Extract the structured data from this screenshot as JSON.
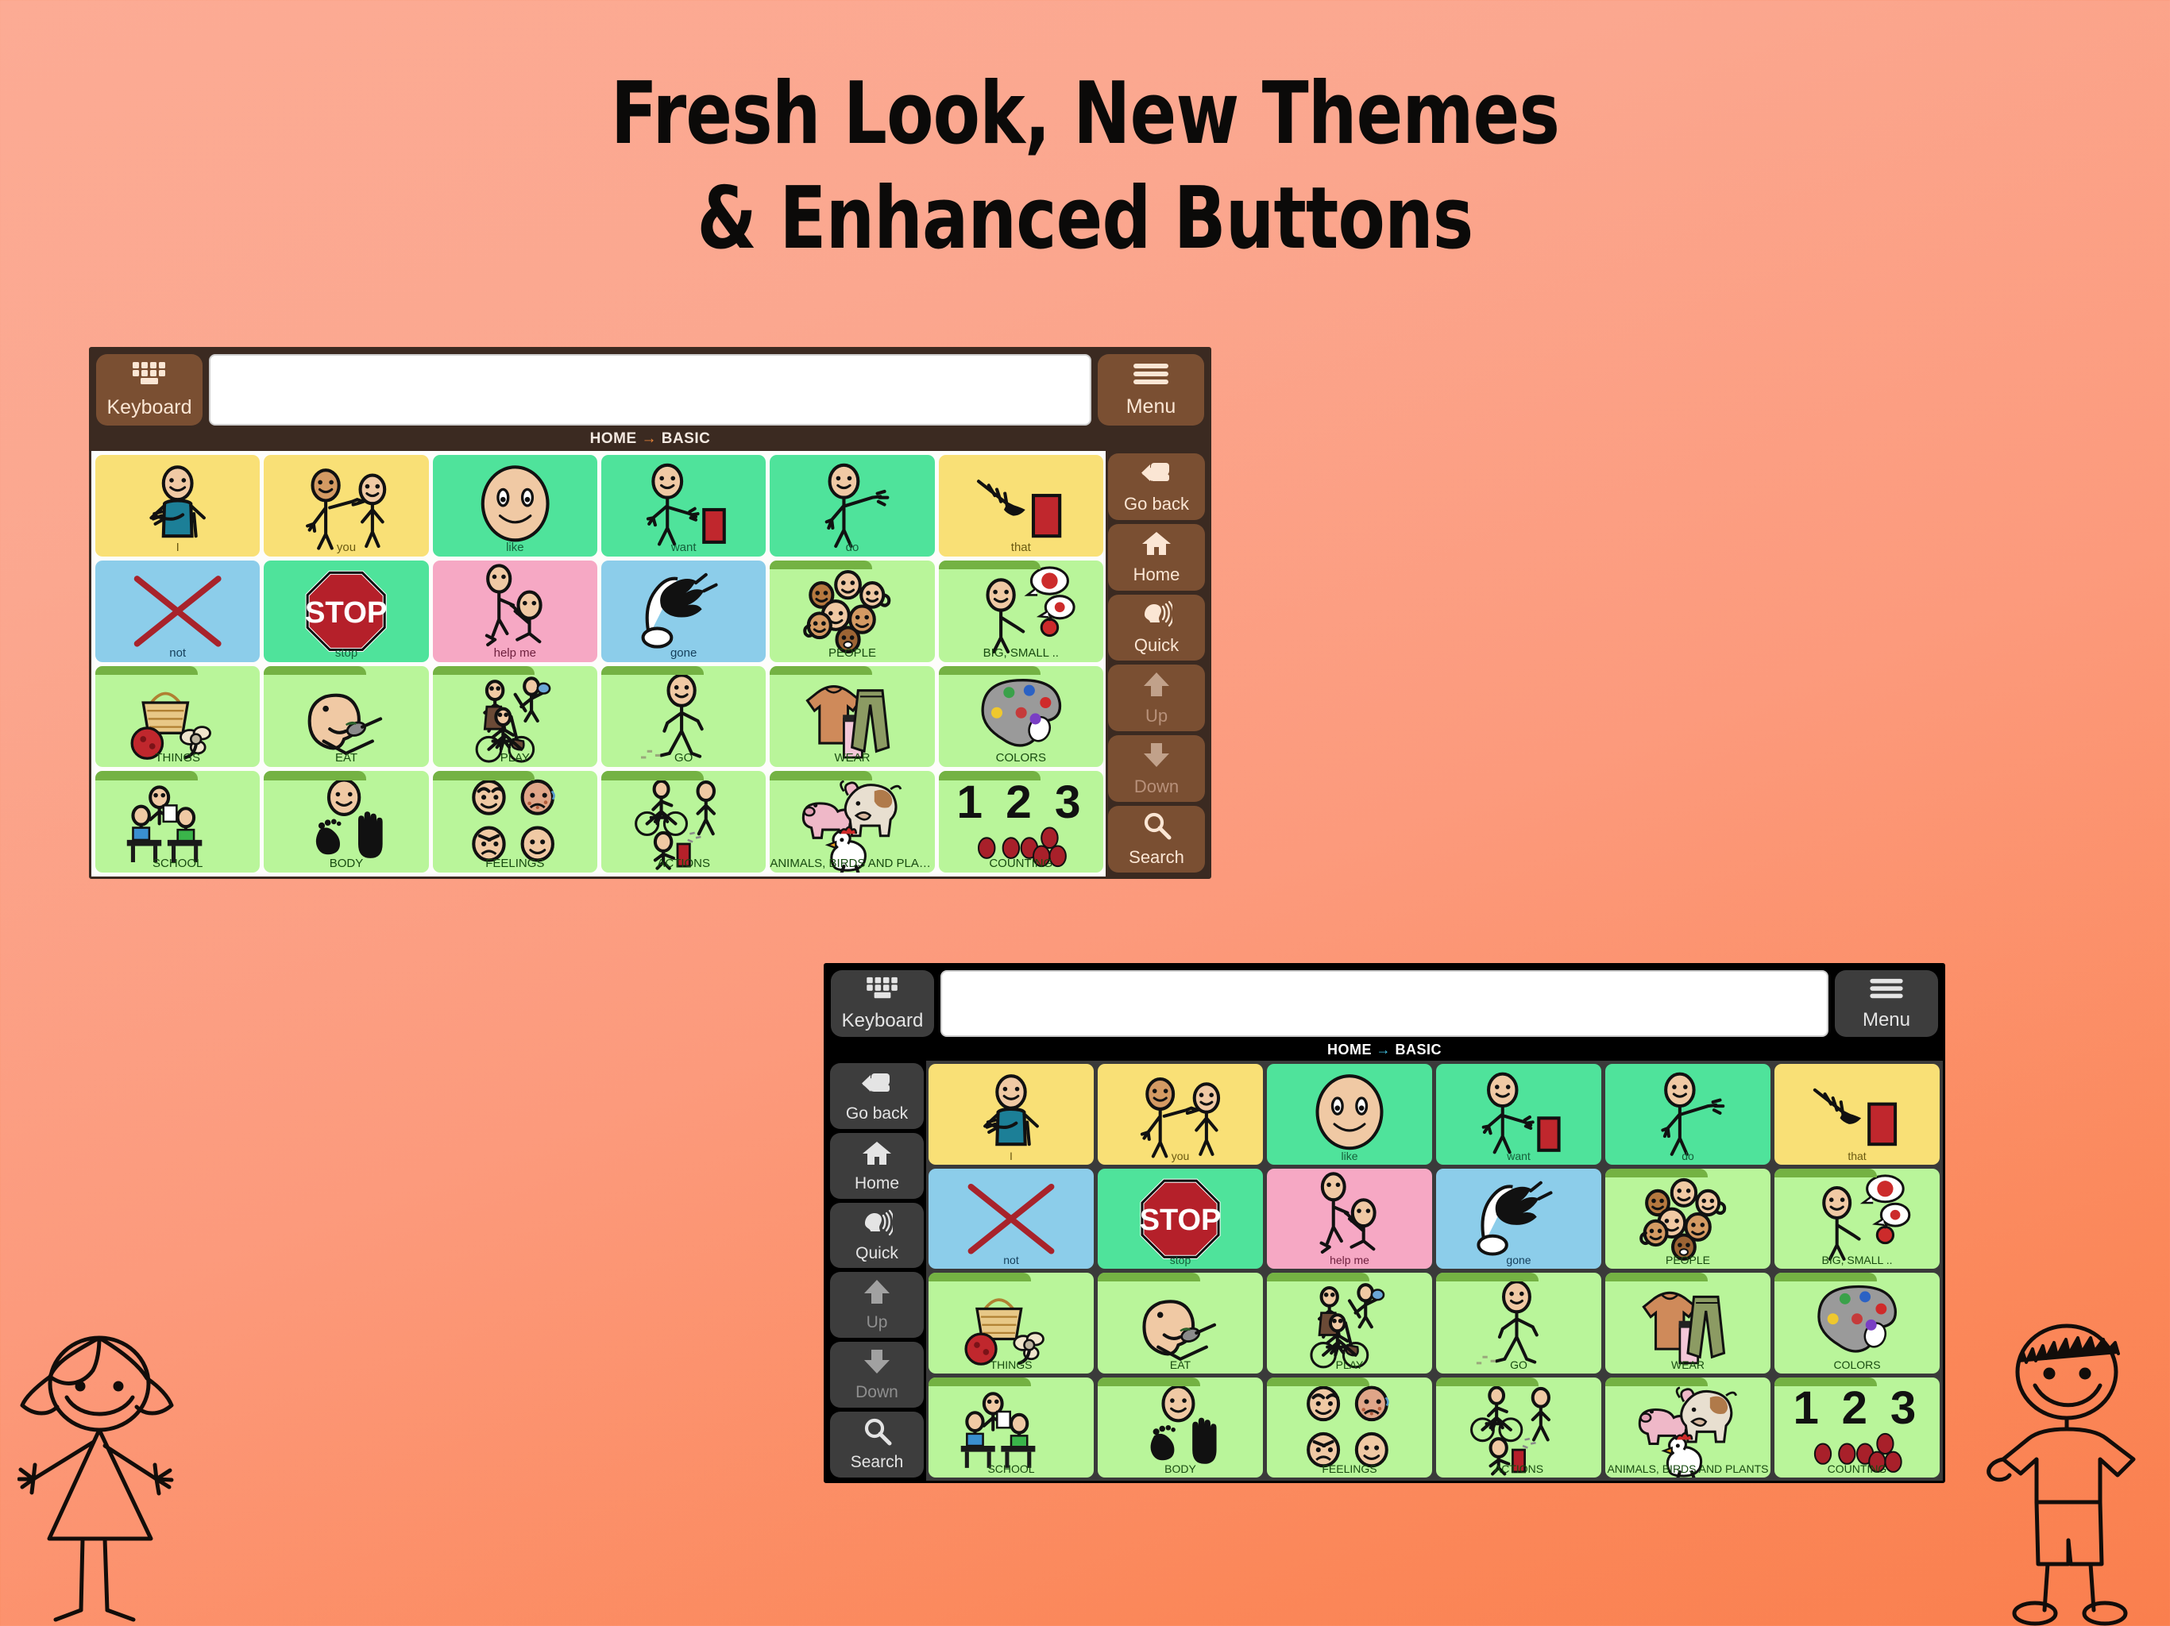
{
  "title": {
    "line1": "Fresh Look, New Themes",
    "line2": "& Enhanced Buttons"
  },
  "colors": {
    "background_start": "#fcab94",
    "background_end": "#fa7f4e",
    "theme1_chrome": "#3b2a21",
    "theme1_button": "#7a4f32",
    "theme1_text": "#fbe6d4",
    "theme1_arrow": "#f0883a",
    "theme2_chrome": "#000000",
    "theme2_button": "#3d3d3d",
    "theme2_text": "#e4e4e4",
    "theme2_arrow": "#45c7e8",
    "cell_yellow": "#f9e076",
    "cell_green": "#4fe39b",
    "cell_blue": "#8ccdea",
    "cell_pink": "#f6a8c4",
    "cell_lightgreen": "#b9f59a",
    "folder_tab": "#74b243"
  },
  "panels": [
    {
      "theme": "brown",
      "rail_side": "right",
      "keyboard_label": "Keyboard",
      "menu_label": "Menu",
      "message_bar_value": "",
      "message_bar_placeholder": "",
      "breadcrumb": {
        "from": "HOME",
        "arrow": "→",
        "to": "BASIC"
      },
      "nav": [
        {
          "label": "Go back",
          "icon": "go-back-icon",
          "disabled": false
        },
        {
          "label": "Home",
          "icon": "home-icon",
          "disabled": false
        },
        {
          "label": "Quick",
          "icon": "quick-speech-icon",
          "disabled": false
        },
        {
          "label": "Up",
          "icon": "arrow-up-icon",
          "disabled": true
        },
        {
          "label": "Down",
          "icon": "arrow-down-icon",
          "disabled": true
        },
        {
          "label": "Search",
          "icon": "search-icon",
          "disabled": false
        }
      ]
    },
    {
      "theme": "dark",
      "rail_side": "left",
      "keyboard_label": "Keyboard",
      "menu_label": "Menu",
      "message_bar_value": "",
      "message_bar_placeholder": "",
      "breadcrumb": {
        "from": "HOME",
        "arrow": "→",
        "to": "BASIC"
      },
      "nav": [
        {
          "label": "Go back",
          "icon": "go-back-icon",
          "disabled": false
        },
        {
          "label": "Home",
          "icon": "home-icon",
          "disabled": false
        },
        {
          "label": "Quick",
          "icon": "quick-speech-icon",
          "disabled": false
        },
        {
          "label": "Up",
          "icon": "arrow-up-icon",
          "disabled": true
        },
        {
          "label": "Down",
          "icon": "arrow-down-icon",
          "disabled": true
        },
        {
          "label": "Search",
          "icon": "search-icon",
          "disabled": false
        }
      ]
    }
  ],
  "grid": {
    "columns": 6,
    "rows": 4,
    "cells": [
      {
        "label": "I",
        "color": "#f9e076",
        "text_color": "#6b5a12",
        "symbol": "person-pointing-self",
        "folder": false
      },
      {
        "label": "you",
        "color": "#f9e076",
        "text_color": "#6b5a12",
        "symbol": "person-pointing-other",
        "folder": false
      },
      {
        "label": "like",
        "color": "#4fe39b",
        "text_color": "#15603a",
        "symbol": "smiling-face",
        "folder": false
      },
      {
        "label": "want",
        "color": "#4fe39b",
        "text_color": "#15603a",
        "symbol": "person-reaching-object",
        "folder": false
      },
      {
        "label": "do",
        "color": "#4fe39b",
        "text_color": "#15603a",
        "symbol": "person-arm-out",
        "folder": false
      },
      {
        "label": "that",
        "color": "#f9e076",
        "text_color": "#6b5a12",
        "symbol": "hand-pointing-object",
        "folder": false
      },
      {
        "label": "not",
        "color": "#8ccdea",
        "text_color": "#16405c",
        "symbol": "red-x-cross",
        "folder": false
      },
      {
        "label": "stop",
        "color": "#4fe39b",
        "text_color": "#15603a",
        "symbol": "stop-sign",
        "folder": false
      },
      {
        "label": "help me",
        "color": "#f6a8c4",
        "text_color": "#6d1f3d",
        "symbol": "person-helping-person",
        "folder": false
      },
      {
        "label": "gone",
        "color": "#8ccdea",
        "text_color": "#16405c",
        "symbol": "hand-wiping-away",
        "folder": false
      },
      {
        "label": "PEOPLE",
        "color": "#b9f59a",
        "text_color": "#184b10",
        "symbol": "group-of-faces",
        "folder": true
      },
      {
        "label": "BIG, SMALL ..",
        "color": "#b9f59a",
        "text_color": "#184b10",
        "symbol": "person-describing-sizes",
        "folder": true
      },
      {
        "label": "THINGS",
        "color": "#b9f59a",
        "text_color": "#184b10",
        "symbol": "basket-ball-toy",
        "folder": true
      },
      {
        "label": "EAT",
        "color": "#b9f59a",
        "text_color": "#184b10",
        "symbol": "face-eating-spoon",
        "folder": true
      },
      {
        "label": "PLAY",
        "color": "#b9f59a",
        "text_color": "#184b10",
        "symbol": "children-playing-bike",
        "folder": true
      },
      {
        "label": "GO",
        "color": "#b9f59a",
        "text_color": "#184b10",
        "symbol": "person-walking",
        "folder": true
      },
      {
        "label": "WEAR",
        "color": "#b9f59a",
        "text_color": "#184b10",
        "symbol": "shirt-and-trousers",
        "folder": true
      },
      {
        "label": "COLORS",
        "color": "#b9f59a",
        "text_color": "#184b10",
        "symbol": "paint-palette",
        "folder": true
      },
      {
        "label": "SCHOOL",
        "color": "#b9f59a",
        "text_color": "#184b10",
        "symbol": "classroom-desks",
        "folder": true
      },
      {
        "label": "BODY",
        "color": "#b9f59a",
        "text_color": "#184b10",
        "symbol": "face-foot-hand",
        "folder": true
      },
      {
        "label": "FEELINGS",
        "color": "#b9f59a",
        "text_color": "#184b10",
        "symbol": "four-emotion-faces",
        "folder": true
      },
      {
        "label": "ACTIONS",
        "color": "#b9f59a",
        "text_color": "#184b10",
        "symbol": "cycling-walking-actions",
        "folder": true
      },
      {
        "label": "ANIMALS, BIRDS AND  PLANTS",
        "color": "#b9f59a",
        "text_color": "#184b10",
        "symbol": "pig-cow-chicken",
        "folder": true
      },
      {
        "label": "COUNTING",
        "color": "#b9f59a",
        "text_color": "#184b10",
        "symbol": "numbers-one-two-three",
        "folder": true
      }
    ]
  },
  "decorations": [
    {
      "name": "stick-figure-girl",
      "position": "bottom-left"
    },
    {
      "name": "stick-figure-boy",
      "position": "bottom-right"
    }
  ]
}
